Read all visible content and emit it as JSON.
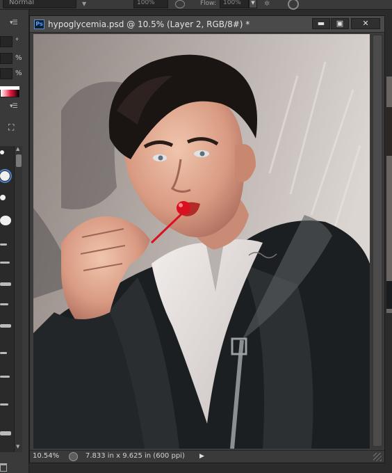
{
  "options_bar": {
    "blend_mode": "Normal",
    "opacity_value": "100%",
    "flow_label": "Flow:",
    "flow_value": "100%"
  },
  "left_panel": {
    "size_unit": "°",
    "hardness_unit": "%",
    "spacing_unit": "%"
  },
  "document": {
    "app_icon": "Ps",
    "title": "hypoglycemia.psd @ 10.5% (Layer 2, RGB/8#) *",
    "minimize_label": "▬",
    "maximize_label": "▣",
    "close_label": "✕"
  },
  "status": {
    "zoom": "10.54%",
    "doc_info": "7.833 in x 9.625 in (600 ppi)",
    "menu_arrow": "▶"
  },
  "colors": {
    "chrome": "#3c3c3c",
    "titlebar": "#4a4a4a",
    "accent": "#4d7ec9",
    "lollipop": "#d81020"
  },
  "icons": [
    "ps-icon",
    "minimize-icon",
    "maximize-icon",
    "close-icon",
    "info-icon",
    "play-arrow-icon",
    "resize-grip-icon",
    "brush-preset-icon",
    "trash-icon",
    "panel-menu-icon"
  ]
}
